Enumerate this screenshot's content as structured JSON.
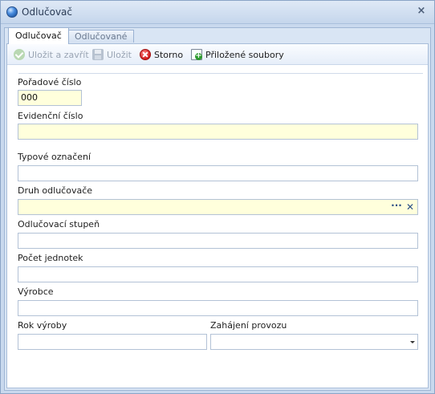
{
  "window": {
    "title": "Odlučovač",
    "close_glyph": "×"
  },
  "tabs": [
    {
      "label": "Odlučovač",
      "active": true
    },
    {
      "label": "Odlučované ZL",
      "active": false
    }
  ],
  "toolbar": {
    "save_close_label": "Uložit a zavřít",
    "save_label": "Uložit",
    "cancel_label": "Storno",
    "attachments_label": "Přiložené soubory"
  },
  "form": {
    "poradove_cislo": {
      "label": "Pořadové číslo",
      "value": "000"
    },
    "evidencni_cislo": {
      "label": "Evidenční číslo",
      "value": ""
    },
    "typove_oznaceni": {
      "label": "Typové označení",
      "value": ""
    },
    "druh_odlucovace": {
      "label": "Druh odlučovače",
      "value": "",
      "dots": "···",
      "clear": "✕"
    },
    "odlucovaci_stupen": {
      "label": "Odlučovací stupeň",
      "value": ""
    },
    "pocet_jednotek": {
      "label": "Počet jednotek",
      "value": ""
    },
    "vyrobce": {
      "label": "Výrobce",
      "value": ""
    },
    "rok_vyroby": {
      "label": "Rok výroby",
      "value": ""
    },
    "zahajeni_provozu": {
      "label": "Zahájení provozu",
      "value": ""
    }
  },
  "colors": {
    "required_field_bg": "#ffffdc",
    "window_frame": "#c9d9ee"
  },
  "icons": [
    "globe-icon",
    "close-icon",
    "check-icon",
    "disk-icon",
    "cancel-icon",
    "attachment-icon",
    "ellipsis-icon",
    "clear-icon",
    "chevron-down-icon"
  ]
}
